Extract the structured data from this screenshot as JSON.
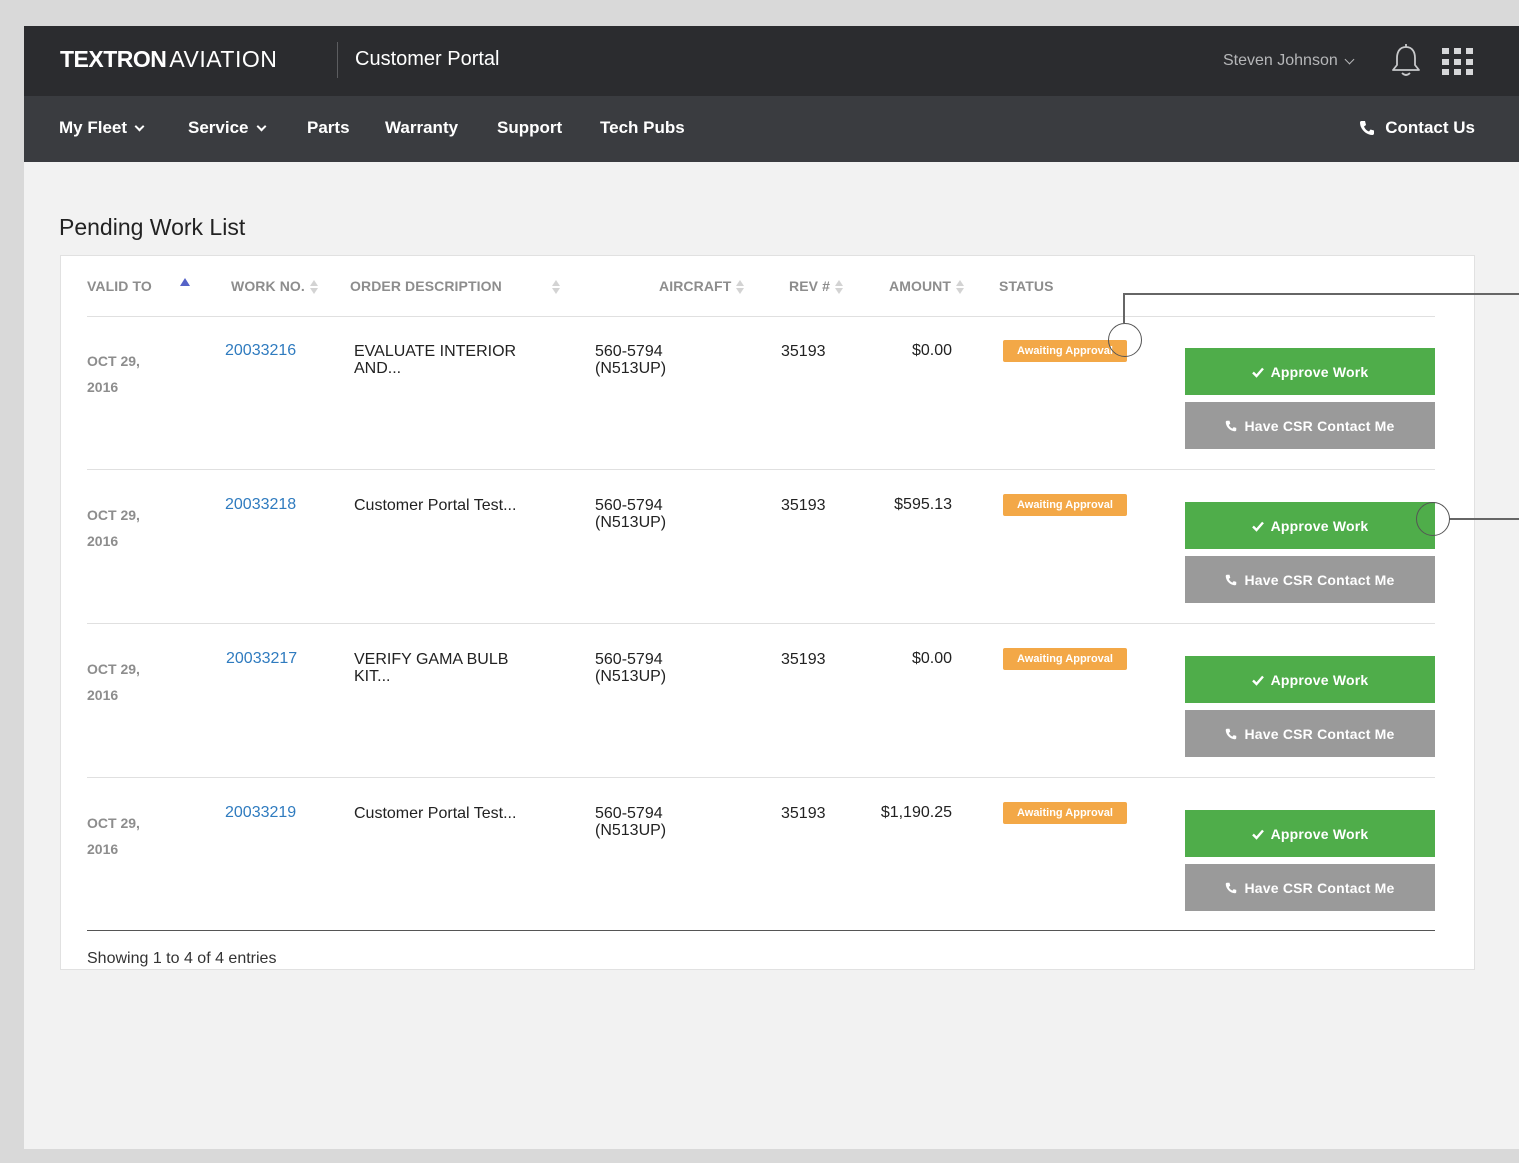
{
  "header": {
    "logo_bold": "TEXTRON",
    "logo_thin": "AVIATION",
    "portal_title": "Customer Portal",
    "user_name": "Steven Johnson"
  },
  "nav": {
    "items": [
      {
        "label": "My Fleet",
        "dropdown": true
      },
      {
        "label": "Service",
        "dropdown": true
      },
      {
        "label": "Parts",
        "dropdown": false
      },
      {
        "label": "Warranty",
        "dropdown": false
      },
      {
        "label": "Support",
        "dropdown": false
      },
      {
        "label": "Tech Pubs",
        "dropdown": false
      }
    ],
    "contact_label": "Contact Us"
  },
  "page": {
    "title": "Pending Work List"
  },
  "table": {
    "columns": [
      "VALID TO",
      "WORK NO.",
      "ORDER DESCRIPTION",
      "AIRCRAFT",
      "REV #",
      "AMOUNT",
      "STATUS"
    ],
    "rows": [
      {
        "date_line1": "OCT 29,",
        "date_line2": "2016",
        "work_no": "20033216",
        "desc_line1": "EVALUATE INTERIOR",
        "desc_line2": "AND...",
        "aircraft_line1": "560-5794",
        "aircraft_line2": "(N513UP)",
        "rev": "35193",
        "amount": "$0.00",
        "status": "Awaiting Approval"
      },
      {
        "date_line1": "OCT 29,",
        "date_line2": "2016",
        "work_no": "20033218",
        "desc_line1": "Customer Portal Test...",
        "desc_line2": "",
        "aircraft_line1": "560-5794",
        "aircraft_line2": "(N513UP)",
        "rev": "35193",
        "amount": "$595.13",
        "status": "Awaiting Approval"
      },
      {
        "date_line1": "OCT 29,",
        "date_line2": "2016",
        "work_no": "20033217",
        "desc_line1": "VERIFY GAMA BULB",
        "desc_line2": "KIT...",
        "aircraft_line1": "560-5794",
        "aircraft_line2": "(N513UP)",
        "rev": "35193",
        "amount": "$0.00",
        "status": "Awaiting Approval"
      },
      {
        "date_line1": "OCT 29,",
        "date_line2": "2016",
        "work_no": "20033219",
        "desc_line1": "Customer Portal Test...",
        "desc_line2": "",
        "aircraft_line1": "560-5794",
        "aircraft_line2": "(N513UP)",
        "rev": "35193",
        "amount": "$1,190.25",
        "status": "Awaiting Approval"
      }
    ],
    "approve_label": "Approve Work",
    "csr_label": "Have CSR Contact Me",
    "footer": "Showing 1 to 4 of 4 entries"
  },
  "colors": {
    "header_bg": "#2b2c2f",
    "nav_bg": "#3a3c40",
    "approve_green": "#4fad4a",
    "csr_gray": "#9a9a9a",
    "badge_orange": "#f3a847",
    "link_blue": "#2f7bbf"
  },
  "icons": {
    "bell": "bell-icon",
    "apps": "apps-grid-icon",
    "phone": "phone-icon",
    "check": "check-icon"
  }
}
